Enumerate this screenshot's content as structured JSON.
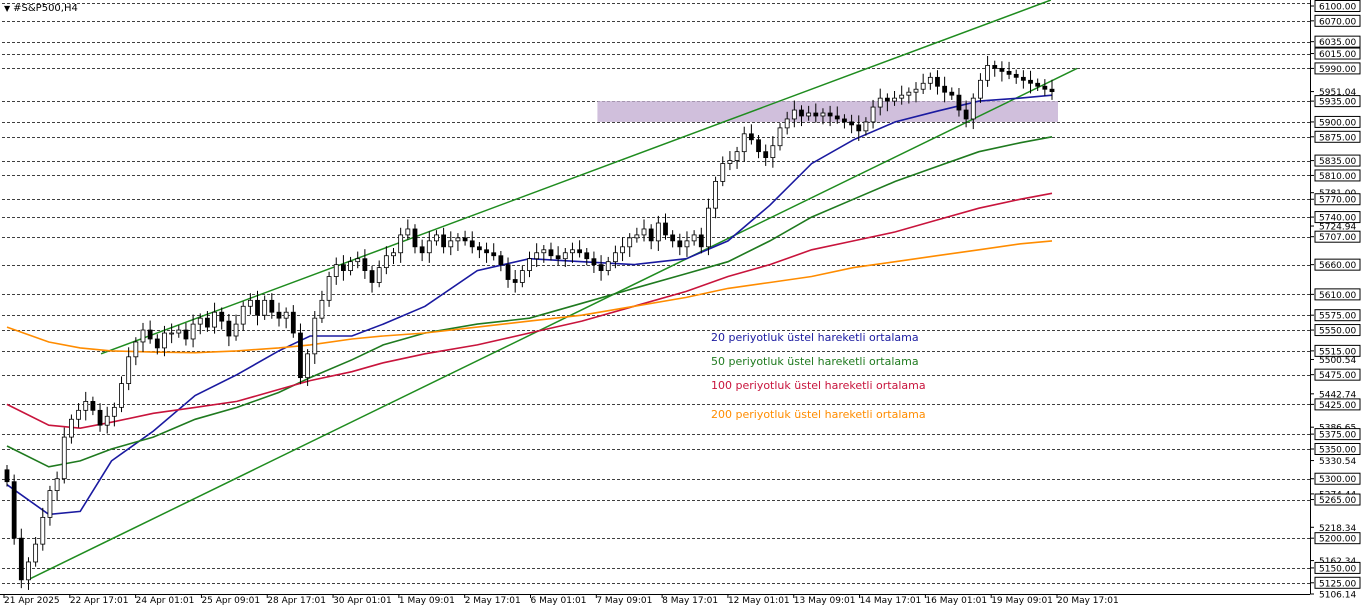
{
  "symbol": "#S&P500,H4",
  "chart_data": {
    "type": "candlestick",
    "title": "#S&P500,H4",
    "ylim": [
      5106.14,
      6100.0
    ],
    "grid": false,
    "y_ticks": [
      "6100.00",
      "6070.00",
      "6035.00",
      "6015.00",
      "5990.00",
      "5951.04",
      "5935.00",
      "5900.00",
      "5875.00",
      "5835.00",
      "5810.00",
      "5781.00",
      "5770.00",
      "5740.00",
      "5724.94",
      "5707.00",
      "5660.00",
      "5610.00",
      "5575.00",
      "5550.00",
      "5515.00",
      "5500.54",
      "5475.00",
      "5442.74",
      "5425.00",
      "5386.65",
      "5375.00",
      "5350.00",
      "5330.54",
      "5300.00",
      "5274.44",
      "5265.00",
      "5218.34",
      "5200.00",
      "5162.34",
      "5150.00",
      "5125.00",
      "5106.14"
    ],
    "level_lines": [
      6100,
      6070,
      6035,
      6015,
      5990,
      5935,
      5900,
      5875,
      5835,
      5810,
      5770,
      5740,
      5707,
      5660,
      5610,
      5575,
      5550,
      5515,
      5475,
      5425,
      5375,
      5350,
      5300,
      5265,
      5200,
      5150,
      5125
    ],
    "highlighted_levels": [
      6100,
      6070,
      6035,
      6015,
      5990,
      5935,
      5900,
      5875,
      5835,
      5810,
      5770,
      5740,
      5707,
      5660,
      5610,
      5575,
      5550,
      5515,
      5475,
      5425,
      5375,
      5350,
      5300,
      5265,
      5200,
      5150,
      5125
    ],
    "current_price": "5951.04",
    "x_labels": [
      "21 Apr 2025",
      "22 Apr 17:01",
      "24 Apr 01:01",
      "25 Apr 09:01",
      "28 Apr 17:01",
      "30 Apr 01:01",
      "1 May 09:01",
      "2 May 17:01",
      "6 May 01:01",
      "7 May 09:01",
      "8 May 17:01",
      "12 May 01:01",
      "13 May 09:01",
      "14 May 17:01",
      "16 May 01:01",
      "19 May 09:01",
      "20 May 17:01"
    ],
    "candles_close": [
      5295,
      5200,
      5130,
      5160,
      5190,
      5235,
      5280,
      5300,
      5370,
      5400,
      5415,
      5430,
      5415,
      5390,
      5405,
      5420,
      5460,
      5505,
      5530,
      5550,
      5535,
      5520,
      5545,
      5545,
      5550,
      5535,
      5560,
      5570,
      5555,
      5580,
      5565,
      5540,
      5560,
      5590,
      5600,
      5575,
      5600,
      5580,
      5570,
      5580,
      5545,
      5470,
      5510,
      5570,
      5600,
      5640,
      5660,
      5650,
      5665,
      5670,
      5650,
      5630,
      5655,
      5675,
      5680,
      5710,
      5720,
      5690,
      5680,
      5700,
      5710,
      5690,
      5700,
      5705,
      5700,
      5690,
      5685,
      5680,
      5675,
      5660,
      5635,
      5630,
      5650,
      5670,
      5680,
      5685,
      5675,
      5670,
      5680,
      5685,
      5680,
      5670,
      5660,
      5650,
      5665,
      5680,
      5690,
      5705,
      5710,
      5720,
      5700,
      5730,
      5710,
      5700,
      5690,
      5700,
      5710,
      5690,
      5755,
      5800,
      5830,
      5835,
      5850,
      5880,
      5870,
      5850,
      5840,
      5860,
      5890,
      5905,
      5920,
      5910,
      5915,
      5910,
      5915,
      5910,
      5905,
      5900,
      5895,
      5885,
      5900,
      5925,
      5940,
      5935,
      5940,
      5945,
      5950,
      5955,
      5965,
      5975,
      5960,
      5950,
      5945,
      5920,
      5905,
      5940,
      5970,
      5995,
      5990,
      5985,
      5980,
      5975,
      5970,
      5965,
      5960,
      5955,
      5951
    ],
    "series": [
      {
        "name": "20 periyotluk üstel hareketli ortalama",
        "color": "#1a1aa0",
        "points": [
          [
            0,
            5290
          ],
          [
            8,
            5240
          ],
          [
            14,
            5245
          ],
          [
            20,
            5330
          ],
          [
            28,
            5380
          ],
          [
            36,
            5440
          ],
          [
            44,
            5475
          ],
          [
            52,
            5515
          ],
          [
            58,
            5540
          ],
          [
            66,
            5540
          ],
          [
            72,
            5560
          ],
          [
            80,
            5590
          ],
          [
            90,
            5650
          ],
          [
            100,
            5670
          ],
          [
            110,
            5665
          ],
          [
            120,
            5660
          ],
          [
            130,
            5670
          ],
          [
            138,
            5700
          ],
          [
            146,
            5760
          ],
          [
            154,
            5830
          ],
          [
            162,
            5870
          ],
          [
            170,
            5900
          ],
          [
            178,
            5918
          ],
          [
            186,
            5935
          ],
          [
            194,
            5940
          ],
          [
            200,
            5945
          ]
        ]
      },
      {
        "name": "50 periyotluk üstel hareketli ortalama",
        "color": "#1f7a1f",
        "points": [
          [
            0,
            5355
          ],
          [
            8,
            5320
          ],
          [
            14,
            5330
          ],
          [
            20,
            5350
          ],
          [
            28,
            5370
          ],
          [
            36,
            5400
          ],
          [
            44,
            5420
          ],
          [
            52,
            5445
          ],
          [
            58,
            5470
          ],
          [
            66,
            5500
          ],
          [
            72,
            5525
          ],
          [
            80,
            5545
          ],
          [
            90,
            5560
          ],
          [
            100,
            5570
          ],
          [
            110,
            5595
          ],
          [
            120,
            5620
          ],
          [
            130,
            5645
          ],
          [
            138,
            5665
          ],
          [
            146,
            5700
          ],
          [
            154,
            5740
          ],
          [
            162,
            5770
          ],
          [
            170,
            5800
          ],
          [
            178,
            5825
          ],
          [
            186,
            5850
          ],
          [
            194,
            5865
          ],
          [
            200,
            5875
          ]
        ]
      },
      {
        "name": "100 periyotluk üstel hareketli ortalama",
        "color": "#c8143c",
        "points": [
          [
            0,
            5425
          ],
          [
            8,
            5390
          ],
          [
            14,
            5385
          ],
          [
            20,
            5395
          ],
          [
            28,
            5410
          ],
          [
            36,
            5420
          ],
          [
            44,
            5430
          ],
          [
            52,
            5450
          ],
          [
            58,
            5465
          ],
          [
            66,
            5480
          ],
          [
            72,
            5495
          ],
          [
            80,
            5510
          ],
          [
            90,
            5525
          ],
          [
            100,
            5545
          ],
          [
            110,
            5565
          ],
          [
            120,
            5590
          ],
          [
            130,
            5615
          ],
          [
            138,
            5640
          ],
          [
            146,
            5660
          ],
          [
            154,
            5685
          ],
          [
            162,
            5700
          ],
          [
            170,
            5715
          ],
          [
            178,
            5735
          ],
          [
            186,
            5755
          ],
          [
            194,
            5770
          ],
          [
            200,
            5780
          ]
        ]
      },
      {
        "name": "200 periyotluk üstel hareketli ortalama",
        "color": "#ff8c00",
        "points": [
          [
            0,
            5555
          ],
          [
            8,
            5530
          ],
          [
            14,
            5520
          ],
          [
            20,
            5515
          ],
          [
            28,
            5513
          ],
          [
            36,
            5512
          ],
          [
            44,
            5515
          ],
          [
            52,
            5520
          ],
          [
            58,
            5525
          ],
          [
            66,
            5535
          ],
          [
            72,
            5540
          ],
          [
            80,
            5545
          ],
          [
            90,
            5555
          ],
          [
            100,
            5565
          ],
          [
            110,
            5575
          ],
          [
            120,
            5590
          ],
          [
            130,
            5605
          ],
          [
            138,
            5620
          ],
          [
            146,
            5630
          ],
          [
            154,
            5640
          ],
          [
            162,
            5655
          ],
          [
            170,
            5665
          ],
          [
            178,
            5675
          ],
          [
            186,
            5685
          ],
          [
            194,
            5695
          ],
          [
            200,
            5700
          ]
        ]
      }
    ],
    "channel_lines": [
      {
        "color": "#1f8c1f",
        "from": [
          18,
          5510
        ],
        "to": [
          195,
          6105
        ]
      },
      {
        "color": "#1f8c1f",
        "from": [
          4,
          5130
        ],
        "to": [
          200,
          5990
        ]
      }
    ],
    "range_box": {
      "fill": "#c8b4d6",
      "y_top": 5935,
      "y_bottom": 5900,
      "x_from": 113,
      "x_to": 200
    }
  }
}
